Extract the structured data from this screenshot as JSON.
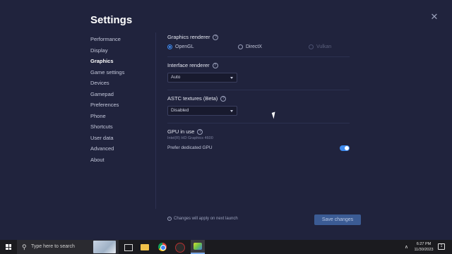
{
  "window": {
    "title": "Settings",
    "close_glyph": "✕"
  },
  "nav": {
    "items": [
      {
        "label": "Performance",
        "active": false
      },
      {
        "label": "Display",
        "active": false
      },
      {
        "label": "Graphics",
        "active": true
      },
      {
        "label": "Game settings",
        "active": false
      },
      {
        "label": "Devices",
        "active": false
      },
      {
        "label": "Gamepad",
        "active": false
      },
      {
        "label": "Preferences",
        "active": false
      },
      {
        "label": "Phone",
        "active": false
      },
      {
        "label": "Shortcuts",
        "active": false
      },
      {
        "label": "User data",
        "active": false
      },
      {
        "label": "Advanced",
        "active": false
      },
      {
        "label": "About",
        "active": false
      }
    ]
  },
  "graphics_renderer": {
    "title": "Graphics renderer",
    "help_glyph": "?",
    "options": [
      {
        "label": "OpenGL",
        "selected": true,
        "disabled": false
      },
      {
        "label": "DirectX",
        "selected": false,
        "disabled": false
      },
      {
        "label": "Vulkan",
        "selected": false,
        "disabled": true
      }
    ]
  },
  "interface_renderer": {
    "title": "Interface renderer",
    "help_glyph": "?",
    "value": "Auto"
  },
  "astc_textures": {
    "title": "ASTC textures (Beta)",
    "help_glyph": "?",
    "value": "Disabled"
  },
  "gpu": {
    "title": "GPU in use",
    "help_glyph": "?",
    "name": "Intel(R) HD Graphics 4600",
    "prefer_dedicated_label": "Prefer dedicated GPU",
    "prefer_dedicated_on": true
  },
  "footer": {
    "note": "Changes will apply on next launch",
    "info_glyph": "i",
    "save_label": "Save changes"
  },
  "taskbar": {
    "search_placeholder": "Type here to search",
    "search_glyph": "⚲",
    "tray_up_glyph": "∧",
    "time": "6:27 PM",
    "date": "11/30/2023",
    "notification_count": "1"
  },
  "colors": {
    "background": "#20233d",
    "accent": "#3e8bf0",
    "save_button": "#3b5b94"
  },
  "icons": [
    "close-icon",
    "help-icon",
    "info-icon",
    "windows-start-icon",
    "search-icon",
    "task-view-icon",
    "file-explorer-icon",
    "chrome-icon",
    "bluestacks-icon"
  ]
}
